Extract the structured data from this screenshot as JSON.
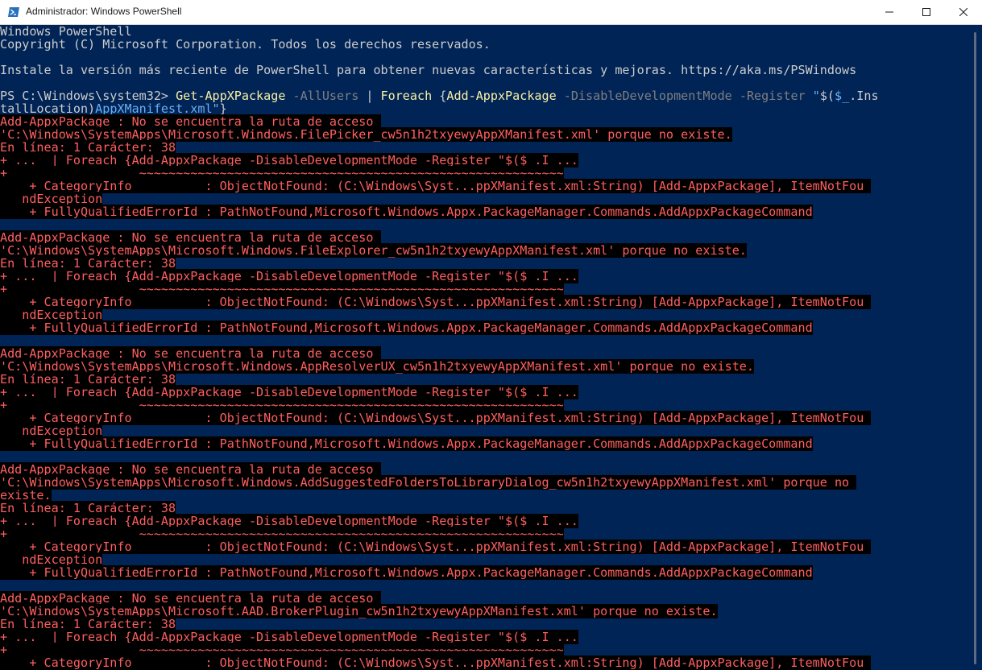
{
  "window": {
    "title": "Administrador: Windows PowerShell",
    "icon": "powershell-icon",
    "controls": [
      "minimize-icon",
      "maximize-icon",
      "close-icon"
    ]
  },
  "colors": {
    "console_bg": "#012456",
    "default_text": "#cccccc",
    "command": "#f9f1a5",
    "parameter": "#7f7f7f",
    "string": "#6ab0f3",
    "error_text": "#ff5f5f",
    "error_bg": "#000000"
  },
  "console": {
    "lines": [
      [
        {
          "t": "Windows PowerShell",
          "c": "w"
        }
      ],
      [
        {
          "t": "Copyright (C) Microsoft Corporation. Todos los derechos reservados.",
          "c": "w"
        }
      ],
      [
        {
          "t": "",
          "c": "w"
        }
      ],
      [
        {
          "t": "Instale la versión más reciente de PowerShell para obtener nuevas características y mejoras. https://aka.ms/PSWindows",
          "c": "w"
        }
      ],
      [
        {
          "t": "",
          "c": "w"
        }
      ],
      [
        {
          "t": "PS C:\\Windows\\system32> ",
          "c": "w"
        },
        {
          "t": "Get-AppXPackage",
          "c": "y"
        },
        {
          "t": " -AllUsers",
          "c": "g"
        },
        {
          "t": " | ",
          "c": "w"
        },
        {
          "t": "Foreach",
          "c": "y"
        },
        {
          "t": " {",
          "c": "w"
        },
        {
          "t": "Add-AppxPackage",
          "c": "y"
        },
        {
          "t": " -DisableDevelopmentMode",
          "c": "g"
        },
        {
          "t": " -Register",
          "c": "g"
        },
        {
          "t": " \"",
          "c": "cy"
        },
        {
          "t": "$(",
          "c": "w"
        },
        {
          "t": "$_",
          "c": "cy"
        },
        {
          "t": ".Ins",
          "c": "w"
        }
      ],
      [
        {
          "t": "tallLocation)",
          "c": "w"
        },
        {
          "t": "AppXManifest.xml\"",
          "c": "cy"
        },
        {
          "t": "}",
          "c": "w"
        }
      ],
      [
        {
          "t": "Add-AppxPackage : No se encuentra la ruta de acceso ",
          "c": "e"
        }
      ],
      [
        {
          "t": "'C:\\Windows\\SystemApps\\Microsoft.Windows.FilePicker_cw5n1h2txyewyAppXManifest.xml' porque no existe.",
          "c": "e"
        }
      ],
      [
        {
          "t": "En línea: 1 Carácter: 38",
          "c": "e"
        }
      ],
      [
        {
          "t": "+ ...  | Foreach {Add-AppxPackage -DisableDevelopmentMode -Register \"$($_.I ...",
          "c": "e"
        }
      ],
      [
        {
          "t": "+                  ~~~~~~~~~~~~~~~~~~~~~~~~~~~~~~~~~~~~~~~~~~~~~~~~~~~~~~~~~~",
          "c": "e"
        }
      ],
      [
        {
          "t": "    + CategoryInfo          : ObjectNotFound: (C:\\Windows\\Syst...ppXManifest.xml:String) [Add-AppxPackage], ItemNotFou ",
          "c": "e"
        }
      ],
      [
        {
          "t": "   ndException",
          "c": "e"
        }
      ],
      [
        {
          "t": "    + FullyQualifiedErrorId : PathNotFound,Microsoft.Windows.Appx.PackageManager.Commands.AddAppxPackageCommand",
          "c": "e"
        }
      ],
      [
        {
          "t": "",
          "c": "w"
        }
      ],
      [
        {
          "t": "Add-AppxPackage : No se encuentra la ruta de acceso ",
          "c": "e"
        }
      ],
      [
        {
          "t": "'C:\\Windows\\SystemApps\\Microsoft.Windows.FileExplorer_cw5n1h2txyewyAppXManifest.xml' porque no existe.",
          "c": "e"
        }
      ],
      [
        {
          "t": "En línea: 1 Carácter: 38",
          "c": "e"
        }
      ],
      [
        {
          "t": "+ ...  | Foreach {Add-AppxPackage -DisableDevelopmentMode -Register \"$($_.I ...",
          "c": "e"
        }
      ],
      [
        {
          "t": "+                  ~~~~~~~~~~~~~~~~~~~~~~~~~~~~~~~~~~~~~~~~~~~~~~~~~~~~~~~~~~",
          "c": "e"
        }
      ],
      [
        {
          "t": "    + CategoryInfo          : ObjectNotFound: (C:\\Windows\\Syst...ppXManifest.xml:String) [Add-AppxPackage], ItemNotFou ",
          "c": "e"
        }
      ],
      [
        {
          "t": "   ndException",
          "c": "e"
        }
      ],
      [
        {
          "t": "    + FullyQualifiedErrorId : PathNotFound,Microsoft.Windows.Appx.PackageManager.Commands.AddAppxPackageCommand",
          "c": "e"
        }
      ],
      [
        {
          "t": "",
          "c": "w"
        }
      ],
      [
        {
          "t": "Add-AppxPackage : No se encuentra la ruta de acceso ",
          "c": "e"
        }
      ],
      [
        {
          "t": "'C:\\Windows\\SystemApps\\Microsoft.Windows.AppResolverUX_cw5n1h2txyewyAppXManifest.xml' porque no existe.",
          "c": "e"
        }
      ],
      [
        {
          "t": "En línea: 1 Carácter: 38",
          "c": "e"
        }
      ],
      [
        {
          "t": "+ ...  | Foreach {Add-AppxPackage -DisableDevelopmentMode -Register \"$($_.I ...",
          "c": "e"
        }
      ],
      [
        {
          "t": "+                  ~~~~~~~~~~~~~~~~~~~~~~~~~~~~~~~~~~~~~~~~~~~~~~~~~~~~~~~~~~",
          "c": "e"
        }
      ],
      [
        {
          "t": "    + CategoryInfo          : ObjectNotFound: (C:\\Windows\\Syst...ppXManifest.xml:String) [Add-AppxPackage], ItemNotFou ",
          "c": "e"
        }
      ],
      [
        {
          "t": "   ndException",
          "c": "e"
        }
      ],
      [
        {
          "t": "    + FullyQualifiedErrorId : PathNotFound,Microsoft.Windows.Appx.PackageManager.Commands.AddAppxPackageCommand",
          "c": "e"
        }
      ],
      [
        {
          "t": "",
          "c": "w"
        }
      ],
      [
        {
          "t": "Add-AppxPackage : No se encuentra la ruta de acceso ",
          "c": "e"
        }
      ],
      [
        {
          "t": "'C:\\Windows\\SystemApps\\Microsoft.Windows.AddSuggestedFoldersToLibraryDialog_cw5n1h2txyewyAppXManifest.xml' porque no ",
          "c": "e"
        }
      ],
      [
        {
          "t": "existe.",
          "c": "e"
        }
      ],
      [
        {
          "t": "En línea: 1 Carácter: 38",
          "c": "e"
        }
      ],
      [
        {
          "t": "+ ...  | Foreach {Add-AppxPackage -DisableDevelopmentMode -Register \"$($_.I ...",
          "c": "e"
        }
      ],
      [
        {
          "t": "+                  ~~~~~~~~~~~~~~~~~~~~~~~~~~~~~~~~~~~~~~~~~~~~~~~~~~~~~~~~~~",
          "c": "e"
        }
      ],
      [
        {
          "t": "    + CategoryInfo          : ObjectNotFound: (C:\\Windows\\Syst...ppXManifest.xml:String) [Add-AppxPackage], ItemNotFou ",
          "c": "e"
        }
      ],
      [
        {
          "t": "   ndException",
          "c": "e"
        }
      ],
      [
        {
          "t": "    + FullyQualifiedErrorId : PathNotFound,Microsoft.Windows.Appx.PackageManager.Commands.AddAppxPackageCommand",
          "c": "e"
        }
      ],
      [
        {
          "t": "",
          "c": "w"
        }
      ],
      [
        {
          "t": "Add-AppxPackage : No se encuentra la ruta de acceso ",
          "c": "e"
        }
      ],
      [
        {
          "t": "'C:\\Windows\\SystemApps\\Microsoft.AAD.BrokerPlugin_cw5n1h2txyewyAppXManifest.xml' porque no existe.",
          "c": "e"
        }
      ],
      [
        {
          "t": "En línea: 1 Carácter: 38",
          "c": "e"
        }
      ],
      [
        {
          "t": "+ ...  | Foreach {Add-AppxPackage -DisableDevelopmentMode -Register \"$($_.I ...",
          "c": "e"
        }
      ],
      [
        {
          "t": "+                  ~~~~~~~~~~~~~~~~~~~~~~~~~~~~~~~~~~~~~~~~~~~~~~~~~~~~~~~~~~",
          "c": "e"
        }
      ],
      [
        {
          "t": "    + CategoryInfo          : ObjectNotFound: (C:\\Windows\\Syst...ppXManifest.xml:String) [Add-AppxPackage], ItemNotFou ",
          "c": "e"
        }
      ]
    ]
  }
}
